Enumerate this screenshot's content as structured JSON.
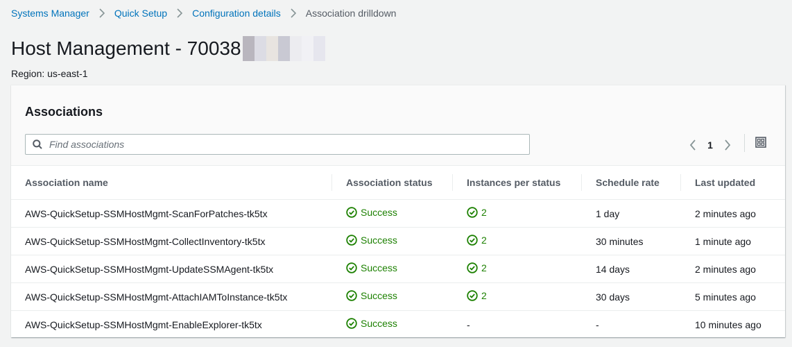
{
  "breadcrumb": {
    "items": [
      "Systems Manager",
      "Quick Setup",
      "Configuration details"
    ],
    "current": "Association drilldown"
  },
  "page": {
    "title": "Host Management - 70038",
    "region": "Region: us-east-1"
  },
  "panel": {
    "title": "Associations",
    "search_placeholder": "Find associations",
    "page_number": "1"
  },
  "table": {
    "columns": [
      "Association name",
      "Association status",
      "Instances per status",
      "Schedule rate",
      "Last updated"
    ],
    "rows": [
      {
        "name": "AWS-QuickSetup-SSMHostMgmt-ScanForPatches-tk5tx",
        "status": "Success",
        "instances": "2",
        "schedule": "1 day",
        "updated": "2 minutes ago"
      },
      {
        "name": "AWS-QuickSetup-SSMHostMgmt-CollectInventory-tk5tx",
        "status": "Success",
        "instances": "2",
        "schedule": "30 minutes",
        "updated": "1 minute ago"
      },
      {
        "name": "AWS-QuickSetup-SSMHostMgmt-UpdateSSMAgent-tk5tx",
        "status": "Success",
        "instances": "2",
        "schedule": "14 days",
        "updated": "2 minutes ago"
      },
      {
        "name": "AWS-QuickSetup-SSMHostMgmt-AttachIAMToInstance-tk5tx",
        "status": "Success",
        "instances": "2",
        "schedule": "30 days",
        "updated": "5 minutes ago"
      },
      {
        "name": "AWS-QuickSetup-SSMHostMgmt-EnableExplorer-tk5tx",
        "status": "Success",
        "instances": "-",
        "schedule": "-",
        "updated": "10 minutes ago"
      }
    ]
  },
  "colors": {
    "link": "#0073bb",
    "success": "#1d8102",
    "background": "#f2f3f3"
  }
}
